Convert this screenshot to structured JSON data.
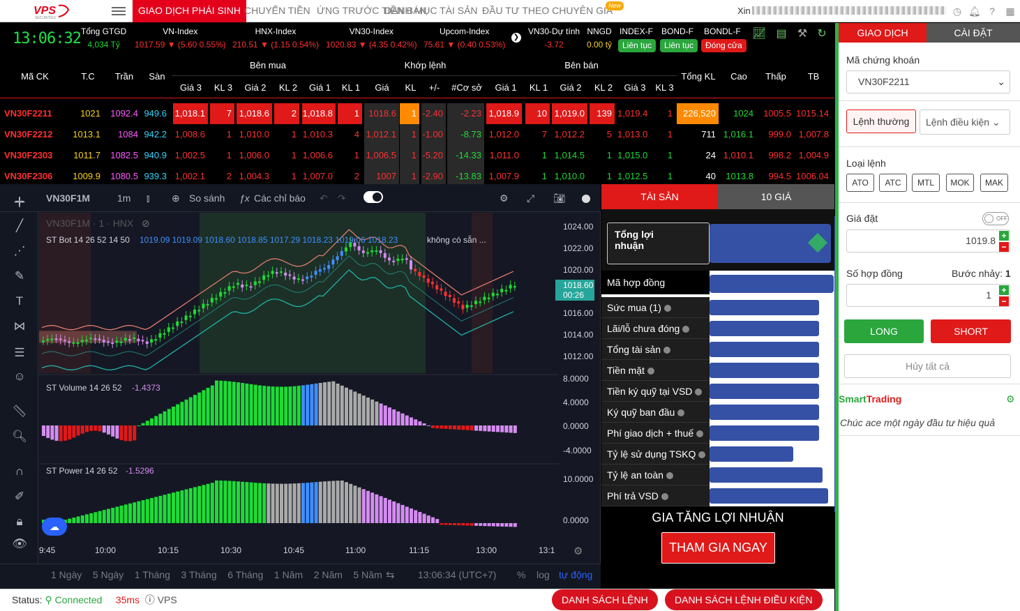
{
  "brand": {
    "logo": "VPS",
    "logo_sub": "SECURITIES"
  },
  "nav": {
    "items": [
      "GIAO DỊCH PHÁI SINH",
      "CHUYỂN TIỀN",
      "ỨNG TRƯỚC TIỀN BÁN",
      "DANH MỤC TÀI SẢN",
      "ĐẦU TƯ THEO CHUYÊN GIA"
    ],
    "new_badge": "New",
    "greeting": "Xin"
  },
  "clock": "13:06:32",
  "indices": [
    {
      "name": "Tổng GTGD",
      "value": "4,034 Tỷ",
      "color": "green"
    },
    {
      "name": "VN-Index",
      "value": "1017.59 ▼ (5.60 0.55%)",
      "color": "red"
    },
    {
      "name": "HNX-Index",
      "value": "210.51 ▼ (1.15 0.54%)",
      "color": "red"
    },
    {
      "name": "VN30-Index",
      "value": "1020.83 ▼ (4.35 0.42%)",
      "color": "red"
    },
    {
      "name": "Upcom-Index",
      "value": "75.61 ▼ (0.40 0.53%)",
      "color": "red"
    },
    {
      "name": "VN30-Dự tính",
      "value": "-3.72",
      "color": "red"
    },
    {
      "name": "NNGD",
      "value": "0.00 tỷ",
      "color": "yellow"
    }
  ],
  "markets": [
    {
      "name": "INDEX-F",
      "status": "Liên tục",
      "color": "#2aa63d"
    },
    {
      "name": "BOND-F",
      "status": "Liên tục",
      "color": "#2aa63d"
    },
    {
      "name": "BONDL-F",
      "status": "Đóng cửa",
      "color": "#e01919"
    }
  ],
  "board": {
    "headers": {
      "ma": "Mã CK",
      "tc": "T.C",
      "tran": "Trần",
      "san": "Sàn",
      "ben_mua": "Bên mua",
      "khop": "Khớp lệnh",
      "ben_ban": "Bên bán",
      "tong_kl": "Tổng KL",
      "cao": "Cao",
      "thap": "Thấp",
      "tb": "TB"
    },
    "sub": [
      "Giá 3",
      "KL 3",
      "Giá 2",
      "KL 2",
      "Giá 1",
      "KL 1",
      "Giá",
      "KL",
      "+/-",
      "#Cơ sở",
      "Giá 1",
      "KL 1",
      "Giá 2",
      "KL 2",
      "Giá 3",
      "KL 3"
    ],
    "rows": [
      [
        "VN30F2211",
        "1021",
        "1092.4",
        "949.6",
        "1,018.1",
        "7",
        "1,018.6",
        "2",
        "1,018.8",
        "1",
        "1018.6",
        "1",
        "-2.40",
        "-2.23",
        "1,018.9",
        "10",
        "1,019.0",
        "139",
        "1,019.4",
        "1",
        "226,520",
        "1024",
        "1005.5",
        "1015.14"
      ],
      [
        "VN30F2212",
        "1013.1",
        "1084",
        "942.2",
        "1,008.6",
        "1",
        "1,010.0",
        "1",
        "1,010.3",
        "4",
        "1,012.1",
        "1",
        "-1.00",
        "-8.73",
        "1,012.0",
        "7",
        "1,012.2",
        "5",
        "1,013.0",
        "1",
        "711",
        "1,016.1",
        "999.0",
        "1,007.8"
      ],
      [
        "VN30F2303",
        "1011.7",
        "1082.5",
        "940.9",
        "1,002.5",
        "1",
        "1,006.0",
        "1",
        "1,006.6",
        "1",
        "1,006.5",
        "1",
        "-5.20",
        "-14.33",
        "1,011.0",
        "1",
        "1,014.5",
        "1",
        "1,015.0",
        "1",
        "24",
        "1,010.1",
        "998.2",
        "1,004.9"
      ],
      [
        "VN30F2306",
        "1009.9",
        "1080.5",
        "939.3",
        "1,002.1",
        "2",
        "1,004.3",
        "1",
        "1,007.0",
        "2",
        "1007",
        "1",
        "-2.90",
        "-13.83",
        "1,007.9",
        "1",
        "1,010.0",
        "1",
        "1,012.5",
        "1",
        "40",
        "1013.8",
        "994.5",
        "1006.04"
      ]
    ]
  },
  "chart": {
    "symbol": "VN30F1M",
    "interval": "1m",
    "compare": "So sánh",
    "indicators": "Các chỉ báo",
    "legend_title": "VN30F1M · 1 · HNX",
    "st_bot": "ST Bot 14 26 52 14 50",
    "st_bot_vals": "1019.09 1019.09 1018.60 1018.85 1017.29 1018.23 1019.06 1018.23",
    "st_bot_na": "không có sẵn ...",
    "price_ticks": [
      "1024.00",
      "1022.00",
      "1020.00",
      "1018.00",
      "1016.00",
      "1014.00",
      "1012.00"
    ],
    "last_price": "1018.60",
    "countdown": "00:26",
    "vol_label": "ST Volume 14 26 52",
    "vol_val": "-1.4373",
    "vol_ticks": [
      "8.0000",
      "4.0000",
      "0.0000",
      "-4.0000"
    ],
    "pow_label": "ST Power 14 26 52",
    "pow_val": "-1.5296",
    "pow_ticks": [
      "10.0000",
      "0.0000"
    ],
    "time_ticks": [
      "9:45",
      "10:00",
      "10:15",
      "10:30",
      "10:45",
      "11:00",
      "11:15",
      "13:00",
      "13:1"
    ],
    "ranges": [
      "1 Ngày",
      "5 Ngày",
      "1 Tháng",
      "3 Tháng",
      "6 Tháng",
      "1 Năm",
      "2 Năm",
      "5 Năm"
    ],
    "clock": "13:06:34 (UTC+7)",
    "pct": "%",
    "log": "log",
    "auto": "tự động"
  },
  "assets": {
    "tabs": [
      "TÀI SẢN",
      "10 GIÁ"
    ],
    "profit": "Tổng lợi nhuận",
    "rows": [
      "Mã hợp đồng",
      "Sức mua (1)",
      "Lãi/lỗ chưa đóng",
      "Tổng tài sản",
      "Tiền mặt",
      "Tiền ký quỹ tại VSD",
      "Ký quỹ ban đầu",
      "Phí giao dịch + thuế",
      "Tỷ lệ sử dụng TSKQ",
      "Tỷ lệ an toàn",
      "Phí trả VSD"
    ],
    "promo": "GIA TĂNG LỢI NHUẬN",
    "cta": "THAM GIA NGAY"
  },
  "order": {
    "tabs": [
      "GIAO DỊCH",
      "CÀI ĐẶT"
    ],
    "symbol_label": "Mã chứng khoán",
    "symbol": "VN30F2211",
    "type_normal": "Lệnh thường",
    "type_cond": "Lệnh điều kiện",
    "order_type_label": "Loại lệnh",
    "order_types": [
      "ATO",
      "ATC",
      "MTL",
      "MOK",
      "MAK"
    ],
    "price_label": "Giá đặt",
    "toggle": "OFF",
    "price": "1019.8",
    "qty_label": "Số hợp đồng",
    "step_label": "Bước nhảy:",
    "step": "1",
    "qty": "1",
    "long": "LONG",
    "short": "SHORT",
    "cancel_all": "Hủy tất cả",
    "smart_a": "Smart",
    "smart_b": "Trading",
    "slogan": "Chúc ace một ngày đầu tư hiệu quả"
  },
  "status": {
    "label": "Status:",
    "conn": "Connected",
    "latency": "35ms",
    "vps": "VPS",
    "btn_orders": "DANH SÁCH LỆNH",
    "btn_cond": "DANH SÁCH LỆNH ĐIỀU KIỆN"
  }
}
